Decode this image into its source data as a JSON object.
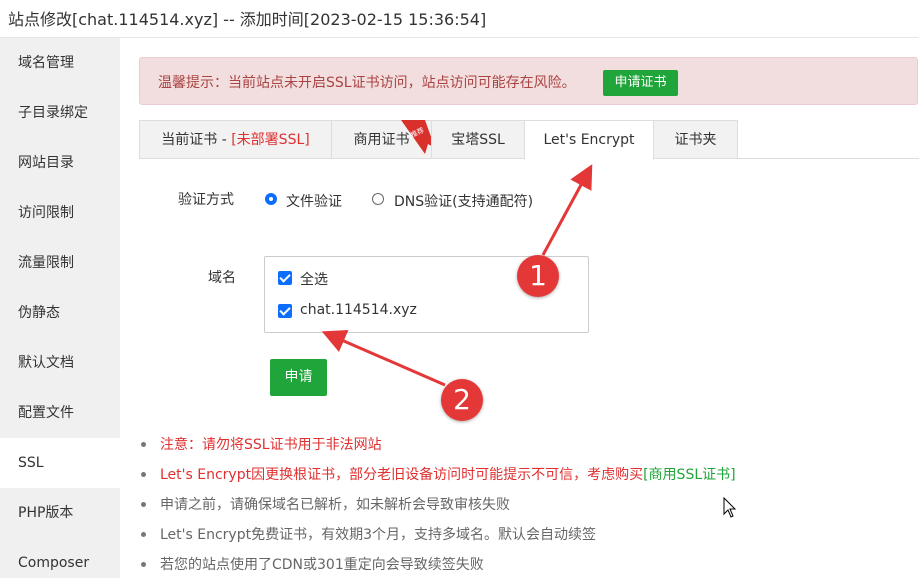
{
  "window": {
    "title": "站点修改[chat.114514.xyz] -- 添加时间[2023-02-15 15:36:54]"
  },
  "sidebar": {
    "items": [
      {
        "label": "域名管理",
        "active": false
      },
      {
        "label": "子目录绑定",
        "active": false
      },
      {
        "label": "网站目录",
        "active": false
      },
      {
        "label": "访问限制",
        "active": false
      },
      {
        "label": "流量限制",
        "active": false
      },
      {
        "label": "伪静态",
        "active": false
      },
      {
        "label": "默认文档",
        "active": false
      },
      {
        "label": "配置文件",
        "active": false
      },
      {
        "label": "SSL",
        "active": true
      },
      {
        "label": "PHP版本",
        "active": false
      },
      {
        "label": "Composer",
        "active": false
      }
    ]
  },
  "alert": {
    "text": "温馨提示：当前站点未开启SSL证书访问，站点访问可能存在风险。",
    "button": "申请证书"
  },
  "tabs": {
    "current_prefix": "当前证书 - ",
    "current_status": "[未部署SSL]",
    "commercial": "商用证书",
    "ribbon": "推荐",
    "baota": "宝塔SSL",
    "letsencrypt": "Let's Encrypt",
    "folder": "证书夹"
  },
  "form": {
    "verify_label": "验证方式",
    "file_verify": "文件验证",
    "dns_verify": "DNS验证(支持通配符)",
    "domain_label": "域名",
    "select_all": "全选",
    "domain": "chat.114514.xyz",
    "apply_button": "申请"
  },
  "notes": [
    {
      "text": "注意：请勿将SSL证书用于非法网站",
      "color": "#e03030"
    },
    {
      "text": "Let's Encrypt因更换根证书，部分老旧设备访问时可能提示不可信，考虑购买",
      "link": "[商用SSL证书]",
      "color": "#e03030"
    },
    {
      "text": "申请之前，请确保域名已解析，如未解析会导致审核失败",
      "color": "#666666"
    },
    {
      "text": "Let's Encrypt免费证书，有效期3个月，支持多域名。默认会自动续签",
      "color": "#666666"
    },
    {
      "text": "若您的站点使用了CDN或301重定向会导致续签失败",
      "color": "#666666"
    }
  ],
  "annotations": {
    "badge1": "1",
    "badge2": "2"
  },
  "colors": {
    "accent_green": "#20a53a",
    "warning_red": "#e03030",
    "annotation_red": "#e43838"
  }
}
